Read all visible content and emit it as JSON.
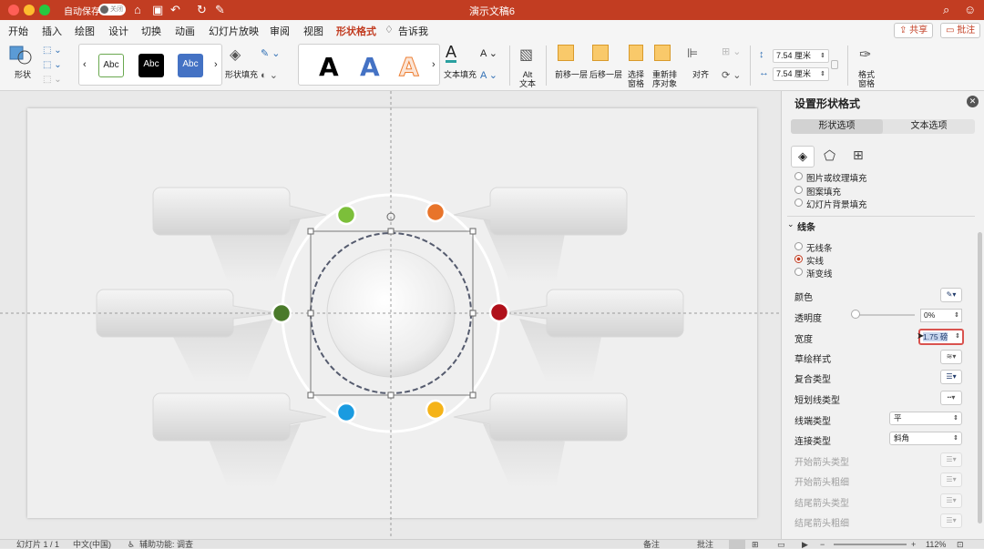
{
  "titlebar": {
    "autosave_label": "自动保存",
    "autosave_state": "关闭",
    "doc_title": "演示文稿6"
  },
  "menu": {
    "items": [
      "开始",
      "插入",
      "绘图",
      "设计",
      "切换",
      "动画",
      "幻灯片放映",
      "审阅",
      "视图",
      "形状格式"
    ],
    "active_index": 9,
    "tell_me": "告诉我",
    "share": "共享",
    "comment": "批注"
  },
  "ribbon": {
    "shape": "形状",
    "style_samples": [
      "Abc",
      "Abc",
      "Abc"
    ],
    "shape_fill": "形状填充",
    "wordart_letter": "A",
    "text_fill": "文本填充",
    "alt_text": "Alt\n文本",
    "bring_forward": "前移一层",
    "send_backward": "后移一层",
    "selection_pane": "选择\n窗格",
    "reorder": "重新排\n序对象",
    "align": "对齐",
    "height": "7.54 厘米",
    "width": "7.54 厘米",
    "format_pane": "格式\n窗格"
  },
  "panel": {
    "title": "设置形状格式",
    "tab_shape": "形状选项",
    "tab_text": "文本选项",
    "fill_options": [
      "图片或纹理填充",
      "图案填充",
      "幻灯片背景填充"
    ],
    "line_section": "线条",
    "line_options": [
      "无线条",
      "实线",
      "渐变线"
    ],
    "line_selected": 1,
    "color": "颜色",
    "transparency": "透明度",
    "transparency_value": "0%",
    "width": "宽度",
    "width_value": "1.75 磅",
    "sketch_style": "草绘样式",
    "compound_type": "复合类型",
    "dash_type": "短划线类型",
    "cap_type": "线端类型",
    "cap_value": "平",
    "join_type": "连接类型",
    "join_value": "斜角",
    "begin_arrow_type": "开始箭头类型",
    "begin_arrow_size": "开始箭头粗细",
    "end_arrow_type": "结尾箭头类型",
    "end_arrow_size": "结尾箭头粗细"
  },
  "status": {
    "slide": "幻灯片 1 / 1",
    "language": "中文(中国)",
    "accessibility": "辅助功能: 调查",
    "notes": "备注",
    "comments": "批注",
    "zoom": "112%"
  },
  "colors": {
    "accent": "#c23d22",
    "dot_green_light": "#7cbf3a",
    "dot_orange": "#e8742a",
    "dot_green_dark": "#4a7a2a",
    "dot_red": "#b0101a",
    "dot_blue": "#1a9be0",
    "dot_yellow": "#f5b318"
  }
}
